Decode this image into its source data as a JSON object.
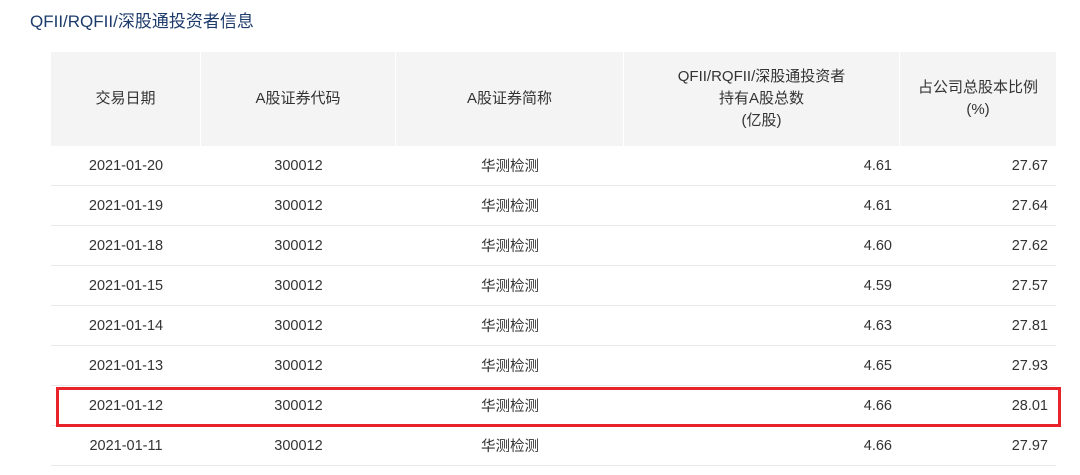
{
  "section": {
    "title": "QFII/RQFII/深股通投资者信息"
  },
  "table": {
    "headers": [
      [
        "交易日期"
      ],
      [
        "A股证券代码"
      ],
      [
        "A股证券简称"
      ],
      [
        "QFII/RQFII/深股通投资者",
        "持有A股总数",
        "(亿股)"
      ],
      [
        "占公司总股本比例",
        "(%)"
      ]
    ],
    "rows": [
      {
        "date": "2021-01-20",
        "code": "300012",
        "name": "华测检测",
        "shares": "4.61",
        "ratio": "27.67"
      },
      {
        "date": "2021-01-19",
        "code": "300012",
        "name": "华测检测",
        "shares": "4.61",
        "ratio": "27.64"
      },
      {
        "date": "2021-01-18",
        "code": "300012",
        "name": "华测检测",
        "shares": "4.60",
        "ratio": "27.62"
      },
      {
        "date": "2021-01-15",
        "code": "300012",
        "name": "华测检测",
        "shares": "4.59",
        "ratio": "27.57"
      },
      {
        "date": "2021-01-14",
        "code": "300012",
        "name": "华测检测",
        "shares": "4.63",
        "ratio": "27.81"
      },
      {
        "date": "2021-01-13",
        "code": "300012",
        "name": "华测检测",
        "shares": "4.65",
        "ratio": "27.93"
      },
      {
        "date": "2021-01-12",
        "code": "300012",
        "name": "华测检测",
        "shares": "4.66",
        "ratio": "28.01"
      },
      {
        "date": "2021-01-11",
        "code": "300012",
        "name": "华测检测",
        "shares": "4.66",
        "ratio": "27.97"
      }
    ],
    "highlighted_row_index": 6
  },
  "colors": {
    "title": "#1d3b6b",
    "header_bg": "#f4f4f4",
    "text": "#333333",
    "highlight_border": "#e8242a"
  }
}
